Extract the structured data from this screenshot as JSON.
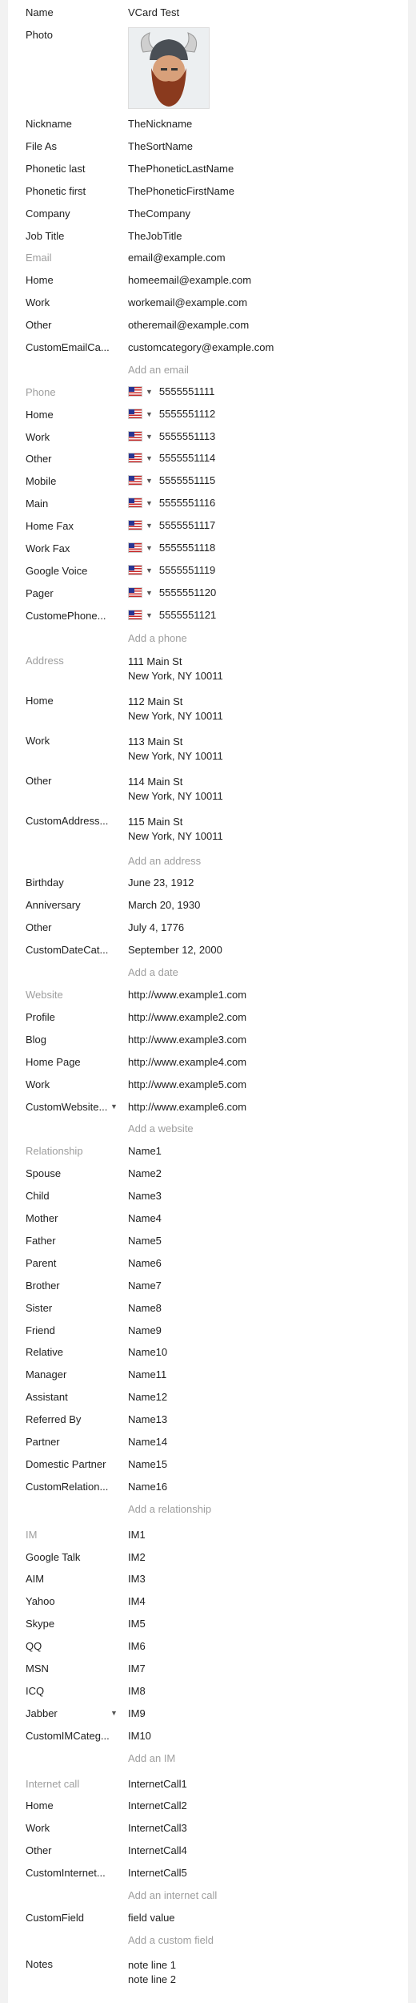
{
  "name": {
    "label": "Name",
    "value": "VCard Test"
  },
  "photo": {
    "label": "Photo",
    "icon": "viking-avatar-photo"
  },
  "fields": [
    {
      "label": "Nickname",
      "value": "TheNickname"
    },
    {
      "label": "File As",
      "value": "TheSortName"
    },
    {
      "label": "Phonetic last",
      "value": "ThePhoneticLastName"
    },
    {
      "label": "Phonetic first",
      "value": "ThePhoneticFirstName"
    },
    {
      "label": "Company",
      "value": "TheCompany"
    },
    {
      "label": "Job Title",
      "value": "TheJobTitle"
    }
  ],
  "email": {
    "header": "Email",
    "header_value": "email@example.com",
    "items": [
      {
        "label": "Home",
        "value": "homeemail@example.com"
      },
      {
        "label": "Work",
        "value": "workemail@example.com"
      },
      {
        "label": "Other",
        "value": "otheremail@example.com"
      },
      {
        "label": "CustomEmailCa...",
        "value": "customcategory@example.com"
      }
    ],
    "add": "Add an email"
  },
  "phone": {
    "header": "Phone",
    "header_value": "5555551111",
    "flag_icon": "us-flag-icon",
    "items": [
      {
        "label": "Home",
        "value": "5555551112"
      },
      {
        "label": "Work",
        "value": "5555551113"
      },
      {
        "label": "Other",
        "value": "5555551114"
      },
      {
        "label": "Mobile",
        "value": "5555551115"
      },
      {
        "label": "Main",
        "value": "5555551116"
      },
      {
        "label": "Home Fax",
        "value": "5555551117"
      },
      {
        "label": "Work Fax",
        "value": "5555551118"
      },
      {
        "label": "Google Voice",
        "value": "5555551119"
      },
      {
        "label": "Pager",
        "value": "5555551120"
      },
      {
        "label": "CustomePhone...",
        "value": "5555551121"
      }
    ],
    "add": "Add a phone"
  },
  "address": {
    "items": [
      {
        "label": "Address",
        "line1": "111 Main St",
        "line2": "New York, NY 10011",
        "header": true
      },
      {
        "label": "Home",
        "line1": "112 Main St",
        "line2": "New York, NY 10011"
      },
      {
        "label": "Work",
        "line1": "113 Main St",
        "line2": "New York, NY 10011"
      },
      {
        "label": "Other",
        "line1": "114 Main St",
        "line2": "New York, NY 10011"
      },
      {
        "label": "CustomAddress...",
        "line1": "115 Main St",
        "line2": "New York, NY 10011"
      }
    ],
    "add": "Add an address"
  },
  "dates": {
    "items": [
      {
        "label": "Birthday",
        "value": "June 23, 1912"
      },
      {
        "label": "Anniversary",
        "value": "March 20, 1930"
      },
      {
        "label": "Other",
        "value": "July 4, 1776"
      },
      {
        "label": "CustomDateCat...",
        "value": "September 12, 2000"
      }
    ],
    "add": "Add a date"
  },
  "website": {
    "header": "Website",
    "header_value": "http://www.example1.com",
    "items": [
      {
        "label": "Profile",
        "value": "http://www.example2.com"
      },
      {
        "label": "Blog",
        "value": "http://www.example3.com"
      },
      {
        "label": "Home Page",
        "value": "http://www.example4.com"
      },
      {
        "label": "Work",
        "value": "http://www.example5.com"
      },
      {
        "label": "CustomWebsite...",
        "value": "http://www.example6.com"
      }
    ],
    "add": "Add a website"
  },
  "relationship": {
    "header": "Relationship",
    "header_value": "Name1",
    "items": [
      {
        "label": "Spouse",
        "value": "Name2"
      },
      {
        "label": "Child",
        "value": "Name3"
      },
      {
        "label": "Mother",
        "value": "Name4"
      },
      {
        "label": "Father",
        "value": "Name5"
      },
      {
        "label": "Parent",
        "value": "Name6"
      },
      {
        "label": "Brother",
        "value": "Name7"
      },
      {
        "label": "Sister",
        "value": "Name8"
      },
      {
        "label": "Friend",
        "value": "Name9"
      },
      {
        "label": "Relative",
        "value": "Name10"
      },
      {
        "label": "Manager",
        "value": "Name11"
      },
      {
        "label": "Assistant",
        "value": "Name12"
      },
      {
        "label": "Referred By",
        "value": "Name13"
      },
      {
        "label": "Partner",
        "value": "Name14"
      },
      {
        "label": "Domestic Partner",
        "value": "Name15"
      },
      {
        "label": "CustomRelation...",
        "value": "Name16"
      }
    ],
    "add": "Add a relationship"
  },
  "im": {
    "header": "IM",
    "header_value": "IM1",
    "items": [
      {
        "label": "Google Talk",
        "value": "IM2"
      },
      {
        "label": "AIM",
        "value": "IM3"
      },
      {
        "label": "Yahoo",
        "value": "IM4"
      },
      {
        "label": "Skype",
        "value": "IM5"
      },
      {
        "label": "QQ",
        "value": "IM6"
      },
      {
        "label": "MSN",
        "value": "IM7"
      },
      {
        "label": "ICQ",
        "value": "IM8"
      },
      {
        "label": "Jabber",
        "value": "IM9"
      },
      {
        "label": "CustomIMCateg...",
        "value": "IM10"
      }
    ],
    "add": "Add an IM"
  },
  "internet_call": {
    "header": "Internet call",
    "header_value": "InternetCall1",
    "items": [
      {
        "label": "Home",
        "value": "InternetCall2"
      },
      {
        "label": "Work",
        "value": "InternetCall3"
      },
      {
        "label": "Other",
        "value": "InternetCall4"
      },
      {
        "label": "CustomInternet...",
        "value": "InternetCall5"
      }
    ],
    "add": "Add an internet call"
  },
  "custom": {
    "label": "CustomField",
    "value": "field value",
    "add": "Add a custom field"
  },
  "notes": {
    "label": "Notes",
    "line1": "note line 1",
    "line2": "note line 2"
  }
}
